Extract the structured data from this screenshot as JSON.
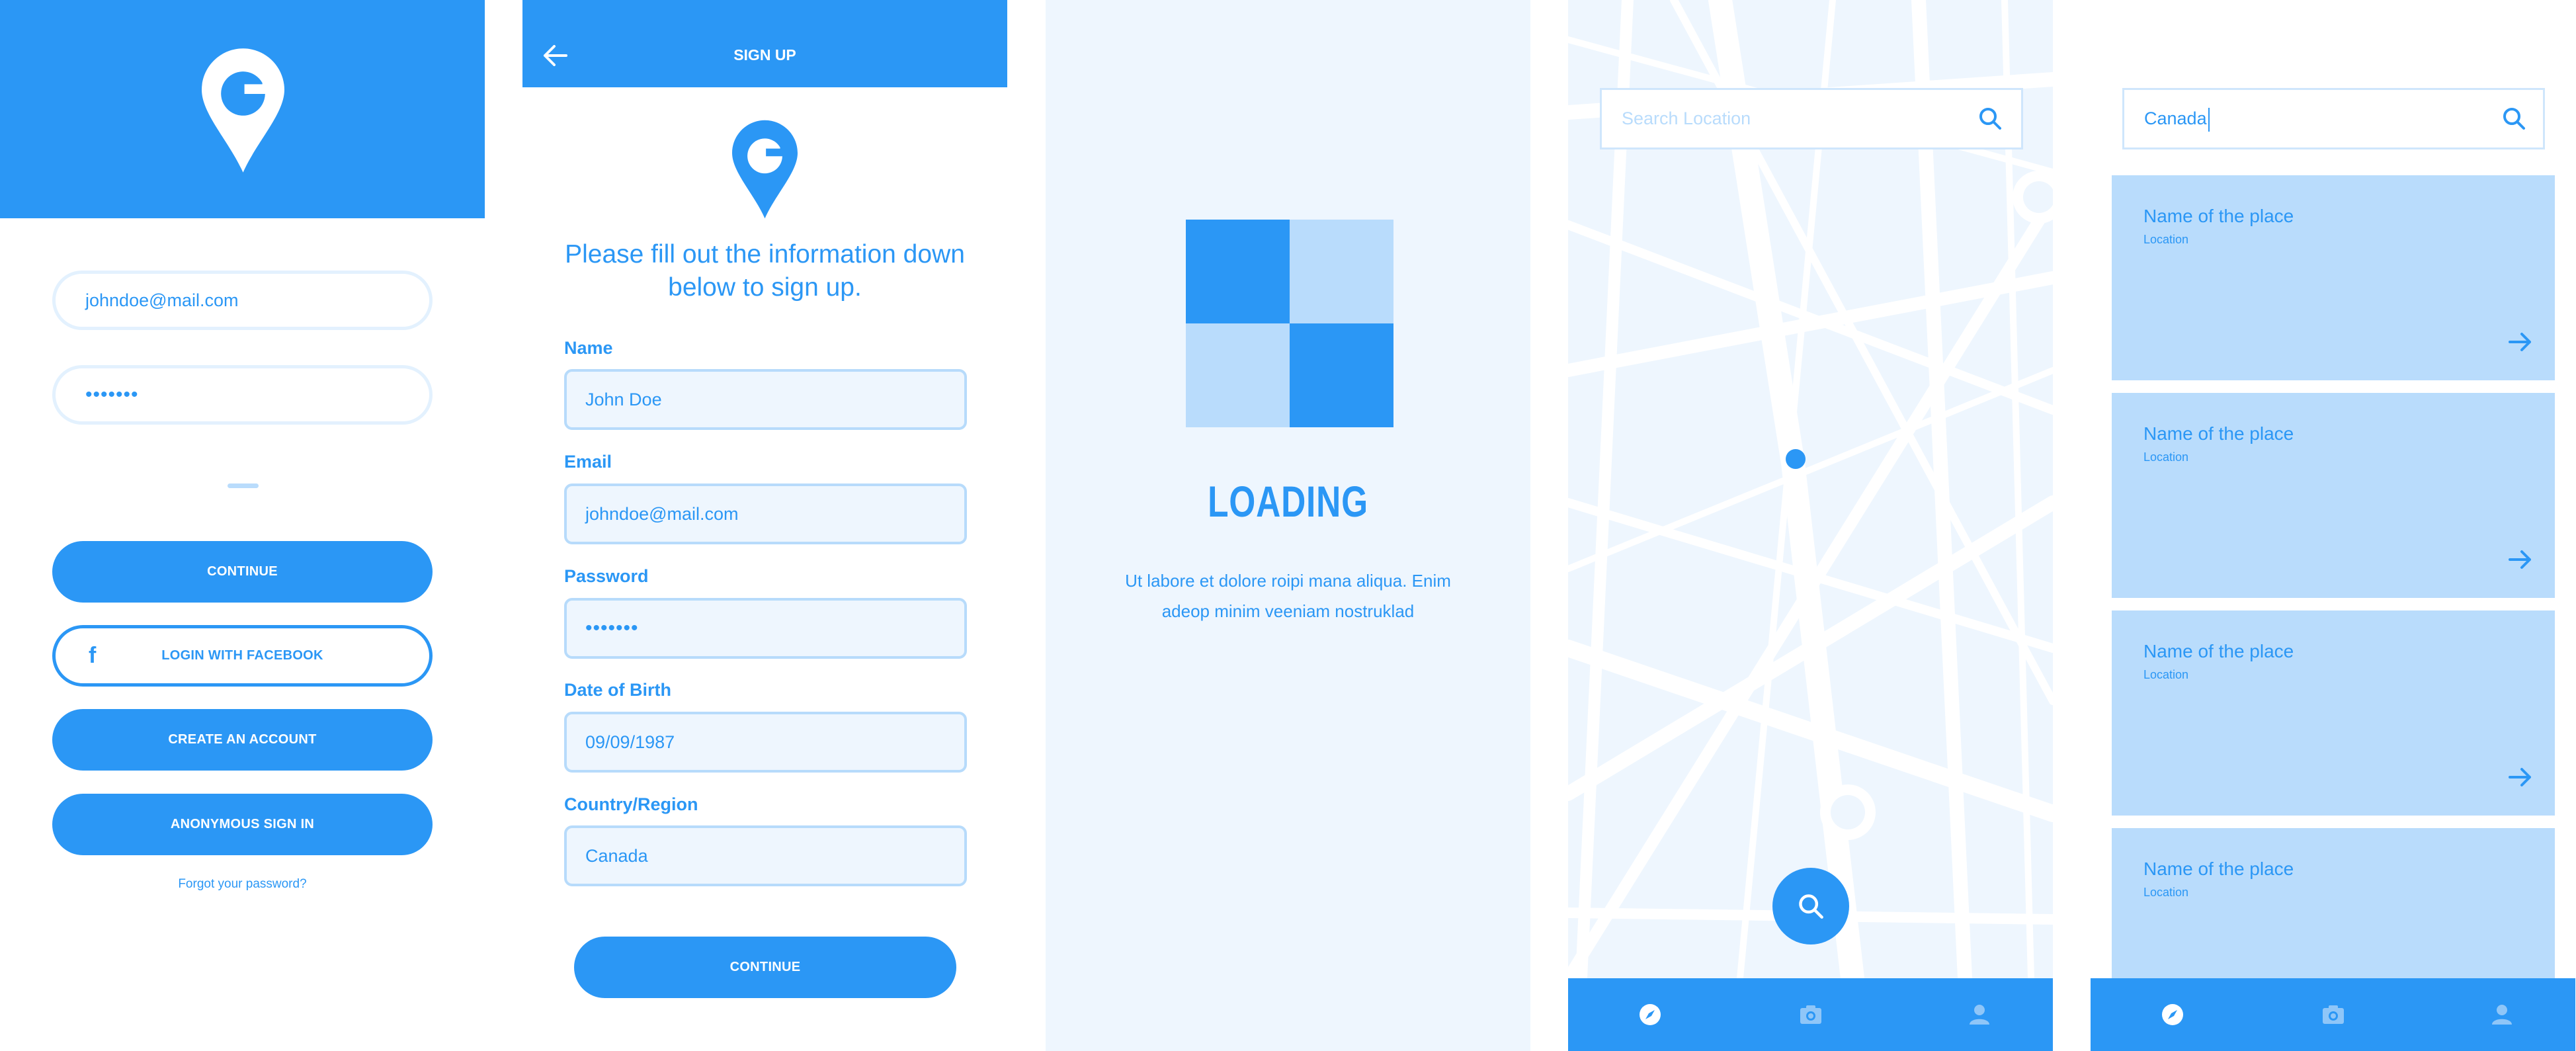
{
  "theme": {
    "primary": "#2b97f5",
    "light": "#b9dcfc",
    "pale": "#eef6fe"
  },
  "login": {
    "logo_icon": "location-pin-g-logo",
    "email_value": "johndoe@mail.com",
    "password_value": "•••••••",
    "continue_label": "CONTINUE",
    "facebook_label": "LOGIN WITH FACEBOOK",
    "create_label": "CREATE AN ACCOUNT",
    "anon_label": "ANONYMOUS SIGN IN",
    "forgot_label": "Forgot your password?"
  },
  "signup": {
    "title": "SIGN UP",
    "intro": "Please fill out the information down below to sign up.",
    "fields": [
      {
        "label": "Name",
        "value": "John Doe"
      },
      {
        "label": "Email",
        "value": "johndoe@mail.com"
      },
      {
        "label": "Password",
        "value": "•••••••"
      },
      {
        "label": "Date of Birth",
        "value": "09/09/1987"
      },
      {
        "label": "Country/Region",
        "value": "Canada"
      }
    ],
    "continue_label": "CONTINUE"
  },
  "loading": {
    "title": "LOADING",
    "text": "Ut labore et dolore roipi mana aliqua. Enim adeop minim veeniam nostruklad"
  },
  "map": {
    "search_placeholder": "Search Location",
    "nav": [
      "compass-icon",
      "camera-icon",
      "user-icon"
    ]
  },
  "results": {
    "search_value": "Canada",
    "items": [
      {
        "name": "Name of the place",
        "location": "Location"
      },
      {
        "name": "Name of the place",
        "location": "Location"
      },
      {
        "name": "Name of the place",
        "location": "Location"
      },
      {
        "name": "Name of the place",
        "location": "Location"
      }
    ],
    "nav": [
      "compass-icon",
      "camera-icon",
      "user-icon"
    ]
  }
}
